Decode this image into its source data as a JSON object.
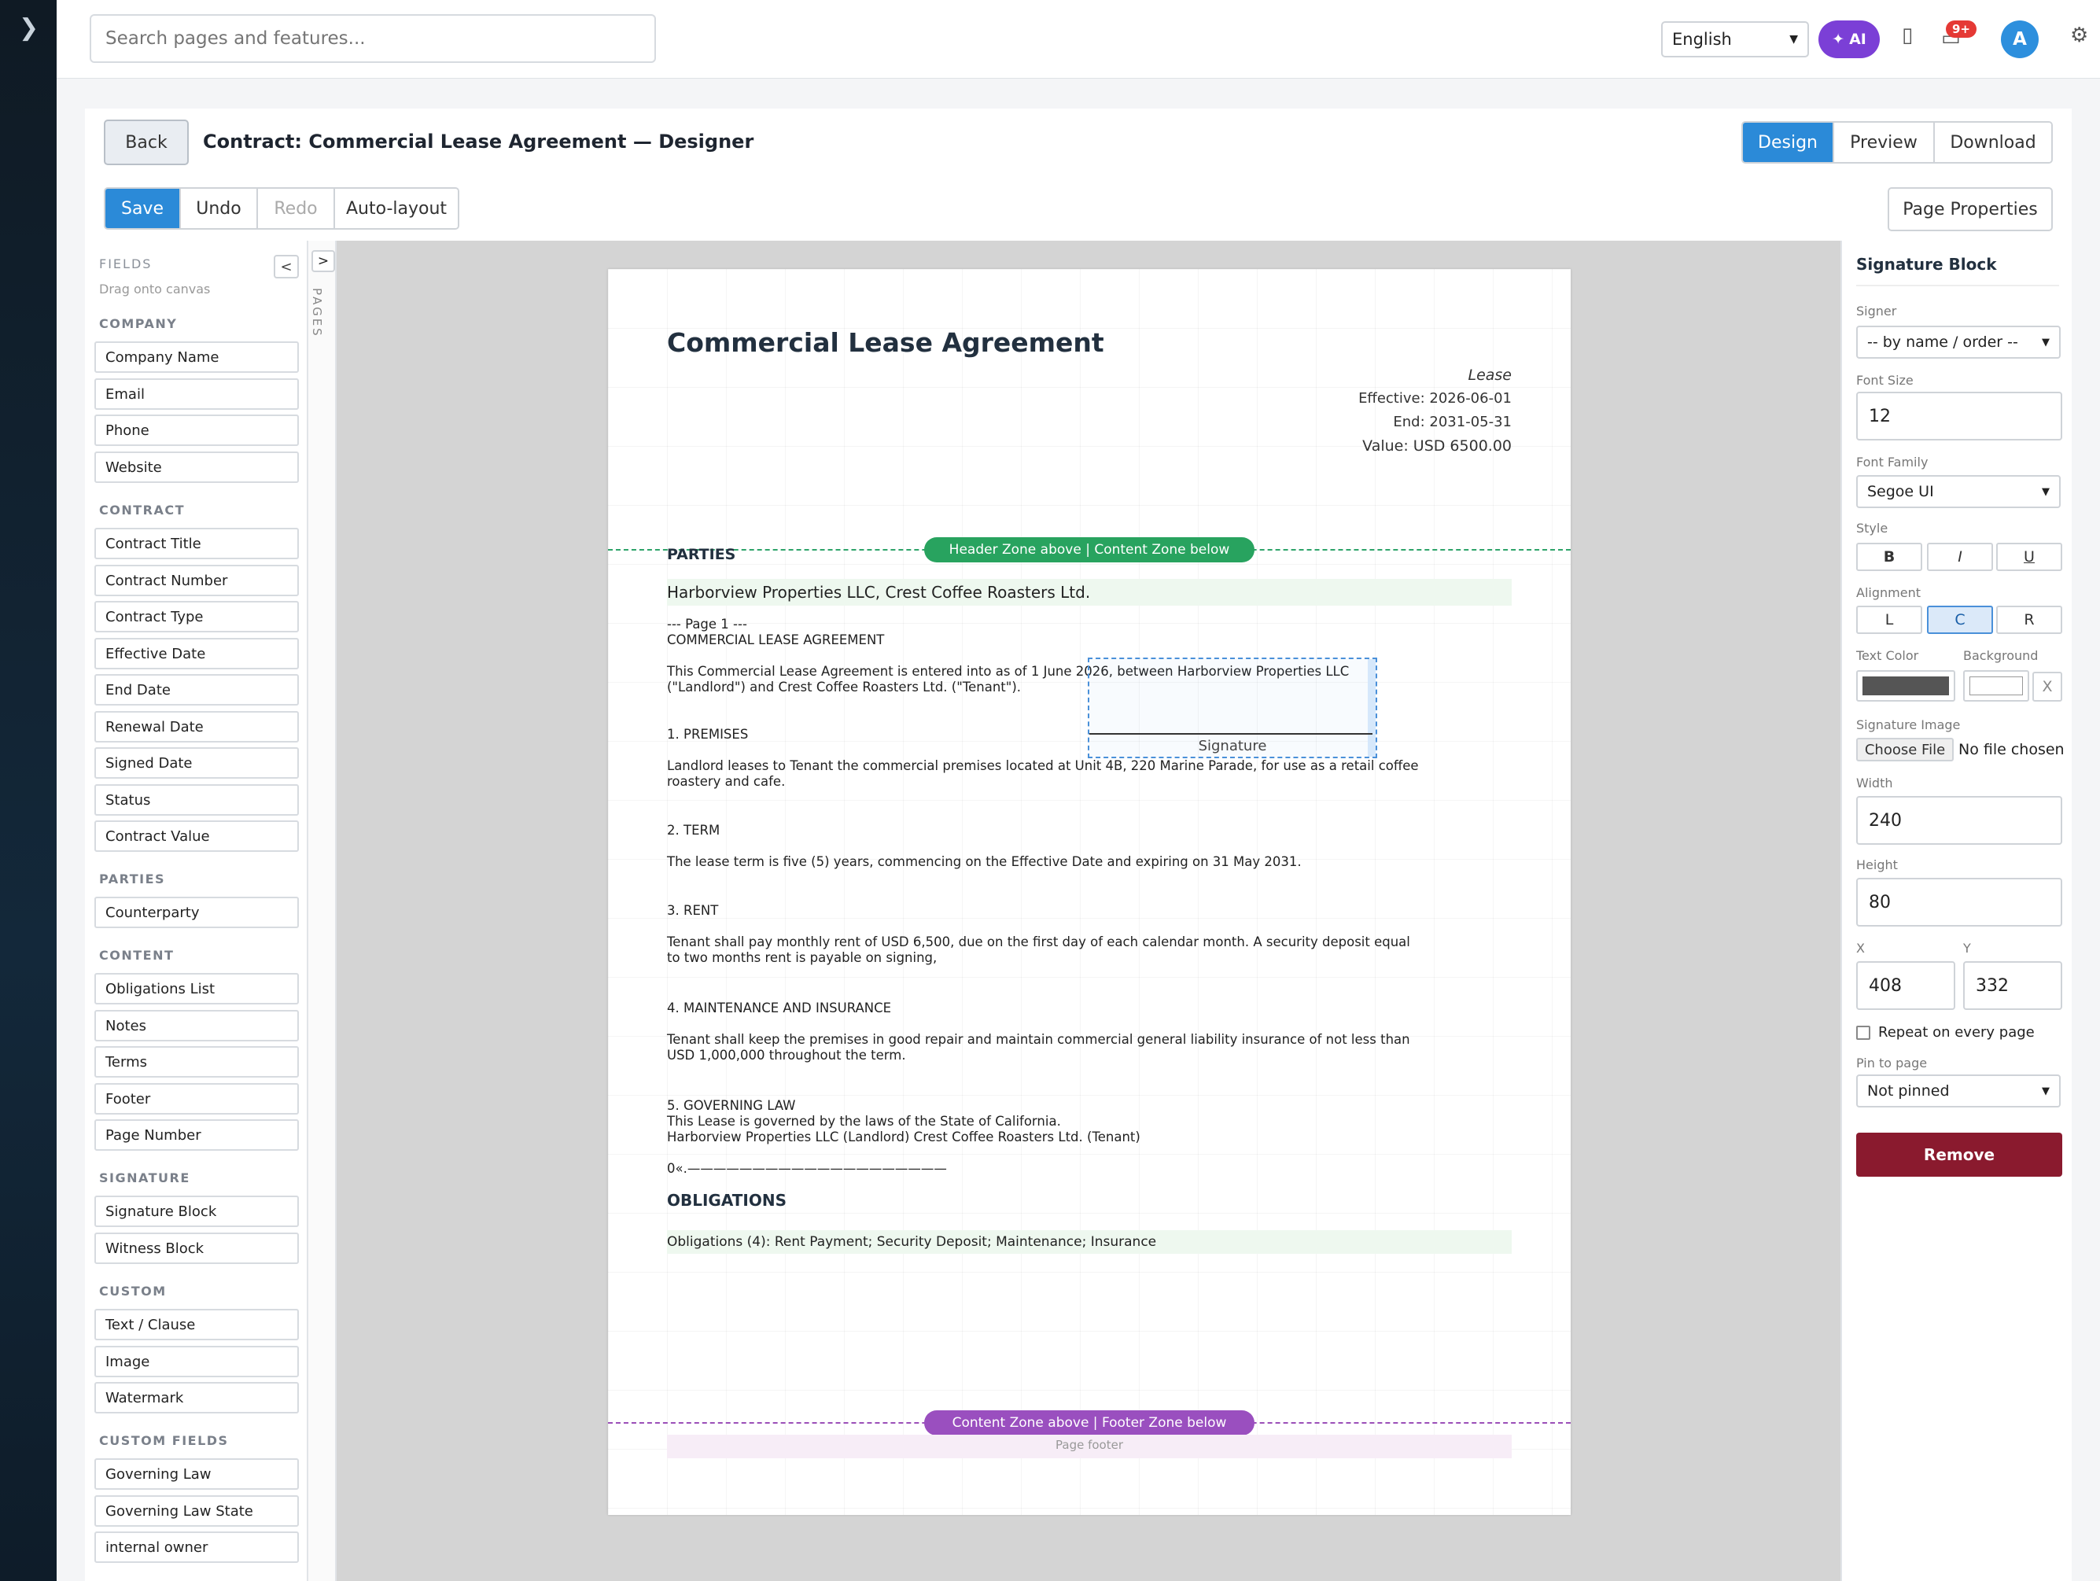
{
  "search": {
    "placeholder": "Search pages and features..."
  },
  "topbar": {
    "language": "English",
    "ai_label": "AI",
    "badge": "9+",
    "avatar_letter": "A"
  },
  "header": {
    "back": "Back",
    "title": "Contract: Commercial Lease Agreement — Designer",
    "modes": [
      "Design",
      "Preview",
      "Download"
    ],
    "active_mode": "Design",
    "toolbar": {
      "save": "Save",
      "undo": "Undo",
      "redo": "Redo",
      "auto_layout": "Auto-layout",
      "page_properties": "Page Properties"
    }
  },
  "sidebar": {
    "heading": "FIELDS",
    "subheading": "Drag onto canvas",
    "collapse": "<",
    "sections": [
      {
        "name": "COMPANY",
        "items": [
          "Company Name",
          "Email",
          "Phone",
          "Website"
        ]
      },
      {
        "name": "CONTRACT",
        "items": [
          "Contract Title",
          "Contract Number",
          "Contract Type",
          "Effective Date",
          "End Date",
          "Renewal Date",
          "Signed Date",
          "Status",
          "Contract Value"
        ]
      },
      {
        "name": "PARTIES",
        "items": [
          "Counterparty"
        ]
      },
      {
        "name": "CONTENT",
        "items": [
          "Obligations List",
          "Notes",
          "Terms",
          "Footer",
          "Page Number"
        ]
      },
      {
        "name": "SIGNATURE",
        "items": [
          "Signature Block",
          "Witness Block"
        ]
      },
      {
        "name": "CUSTOM",
        "items": [
          "Text / Clause",
          "Image",
          "Watermark"
        ]
      },
      {
        "name": "CUSTOM FIELDS",
        "items": [
          "Governing Law",
          "Governing Law State",
          "internal owner"
        ]
      }
    ]
  },
  "pages_tab": {
    "button": ">",
    "label": "PAGES"
  },
  "document": {
    "title": "Commercial Lease Agreement",
    "meta": {
      "type": "Lease",
      "effective": "Effective: 2026-06-01",
      "end": "End: 2031-05-31",
      "value": "Value: USD 6500.00"
    },
    "header_zone": "Header Zone above | Content Zone below",
    "footer_zone": "Content Zone above | Footer Zone below",
    "parties_title": "PARTIES",
    "parties": "Harborview Properties LLC, Crest Coffee Roasters Ltd.",
    "body": {
      "intro": "--- Page 1 ---\nCOMMERCIAL LEASE AGREEMENT",
      "p1": "This Commercial Lease Agreement is entered into as of 1 June 2026, between Harborview Properties LLC\n(\"Landlord\") and Crest Coffee Roasters Ltd. (\"Tenant\").",
      "s1": "1. PREMISES",
      "p2": "Landlord leases to Tenant the commercial premises located at Unit 4B, 220 Marine Parade, for use as a retail coffee\nroastery and cafe.",
      "s2": "2. TERM",
      "p3": "The lease term is five (5) years, commencing on the Effective Date and expiring on 31 May 2031.",
      "s3": "3. RENT",
      "p4": "Tenant shall pay monthly rent of USD 6,500, due on the first day of each calendar month. A security deposit equal\nto two months rent is payable on signing,",
      "s4": "4. MAINTENANCE AND INSURANCE",
      "p5": "Tenant shall keep the premises in good repair and maintain commercial general liability insurance of not less than\nUSD 1,000,000 throughout the term.",
      "s5": "5. GOVERNING LAW\nThis Lease is governed by the laws of the State of California.\nHarborview Properties LLC (Landlord) Crest Coffee Roasters Ltd. (Tenant)",
      "sigline": "0«.————————————————————"
    },
    "obligations_title": "OBLIGATIONS",
    "obligations": "Obligations (4): Rent Payment; Security Deposit; Maintenance; Insurance",
    "signature_label": "Signature",
    "footer_label": "Page footer"
  },
  "panel": {
    "title": "Signature Block",
    "signer_label": "Signer",
    "signer_value": "-- by name / order --",
    "font_size_label": "Font Size",
    "font_size": "12",
    "font_family_label": "Font Family",
    "font_family": "Segoe UI",
    "style_label": "Style",
    "style_buttons": [
      "B",
      "I",
      "U"
    ],
    "alignment_label": "Alignment",
    "alignment_buttons": [
      "L",
      "C",
      "R"
    ],
    "alignment_selected": "C",
    "text_color_label": "Text Color",
    "background_label": "Background",
    "clear": "X",
    "text_color": "#555555",
    "background_color": "#ffffff",
    "sig_image_label": "Signature Image",
    "choose_file": "Choose File",
    "no_file": "No file chosen",
    "width_label": "Width",
    "width": "240",
    "height_label": "Height",
    "height": "80",
    "x_label": "X",
    "x": "408",
    "y_label": "Y",
    "y": "332",
    "repeat_label": "Repeat on every page",
    "pin_label": "Pin to page",
    "pin_value": "Not pinned",
    "remove": "Remove"
  }
}
